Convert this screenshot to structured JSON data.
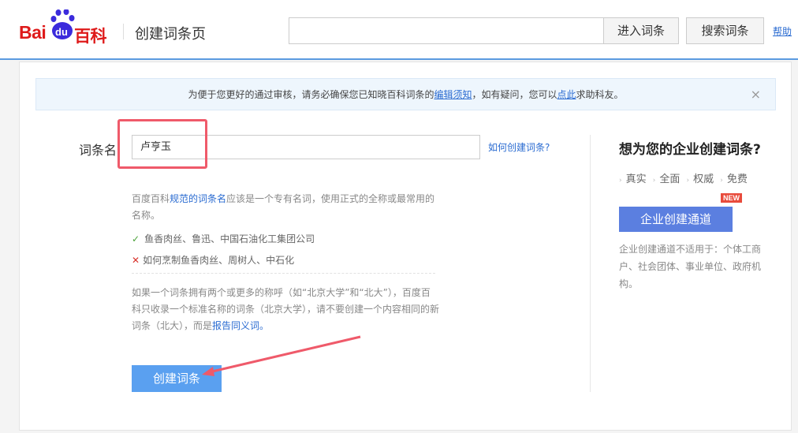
{
  "header": {
    "logo": "Baidu百科",
    "page_name": "创建词条页",
    "search_value": "",
    "enter_button": "进入词条",
    "search_button": "搜索词条",
    "help_link": "帮助"
  },
  "notice": {
    "text_before": "为便于您更好的通过审核，请务必确保您已知晓百科词条的",
    "link1": "编辑须知",
    "text_middle": "，如有疑问，您可以",
    "link2": "点此",
    "text_after": "求助科友。",
    "close_icon": "×"
  },
  "form": {
    "label": "词条名",
    "name_value": "卢亨玉",
    "howto_link": "如何创建词条?",
    "hint_before": "百度百科",
    "hint_link": "规范的词条名",
    "hint_after": "应该是一个专有名词，使用正式的全称或最常用的名称。",
    "good_example": "鱼香肉丝、鲁迅、中国石油化工集团公司",
    "bad_example": "如何烹制鱼香肉丝、周树人、中石化",
    "hint2_before": "如果一个词条拥有两个或更多的称呼（如“北京大学”和“北大”），百度百科只收录一个标准名称的词条（北京大学），请不要创建一个内容相同的新词条（北大），而是",
    "hint2_link": "报告同义词。",
    "create_button": "创建词条"
  },
  "enterprise": {
    "title": "想为您的企业创建词条?",
    "features": [
      "真实",
      "全面",
      "权威",
      "免费"
    ],
    "button": "企业创建通道",
    "badge": "NEW",
    "note": "企业创建通道不适用于：个体工商户、社会团体、事业单位、政府机构。"
  },
  "colors": {
    "accent": "#5aa0f0",
    "enterprise": "#5b7fe0",
    "annotation": "#ef5a6a",
    "link": "#2a6bd1"
  }
}
